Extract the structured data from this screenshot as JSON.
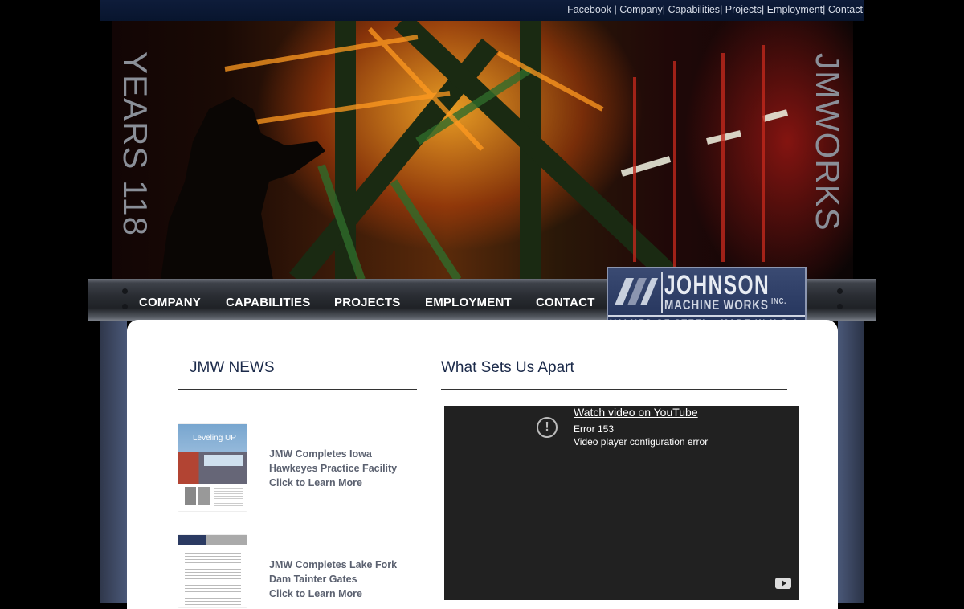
{
  "top_links": [
    "Facebook",
    "Company",
    "Capabilities",
    "Projects",
    "Employment",
    "Contact"
  ],
  "hero": {
    "left_text": "YEARS 118",
    "right_text": "JMWORKS"
  },
  "nav": {
    "items": [
      "COMPANY",
      "CAPABILITIES",
      "PROJECTS",
      "EMPLOYMENT",
      "CONTACT"
    ]
  },
  "logo": {
    "name": "JOHNSON",
    "sub": "MACHINE WORKS",
    "inc": "INC.",
    "tagline": "VALUES OF STEEL  •  MADE IN U.S.A."
  },
  "news": {
    "heading": "JMW NEWS",
    "thumb1_title": "Leveling UP",
    "items": [
      {
        "line1": "JMW Completes Iowa",
        "line2": "Hawkeyes Practice Facility",
        "line3": "Click to Learn More"
      },
      {
        "line1": "JMW Completes Lake Fork",
        "line2": "Dam Tainter Gates",
        "line3": "Click to Learn More"
      }
    ]
  },
  "apart": {
    "heading": "What Sets Us Apart",
    "video": {
      "watch_label": "Watch video on YouTube",
      "error_code": "Error 153",
      "error_msg": "Video player configuration error"
    }
  },
  "colors": {
    "topbar": "#0e1c3a",
    "logo_bg": "#2b3b63",
    "heading": "#1b2a4a",
    "link": "#5b6170"
  }
}
